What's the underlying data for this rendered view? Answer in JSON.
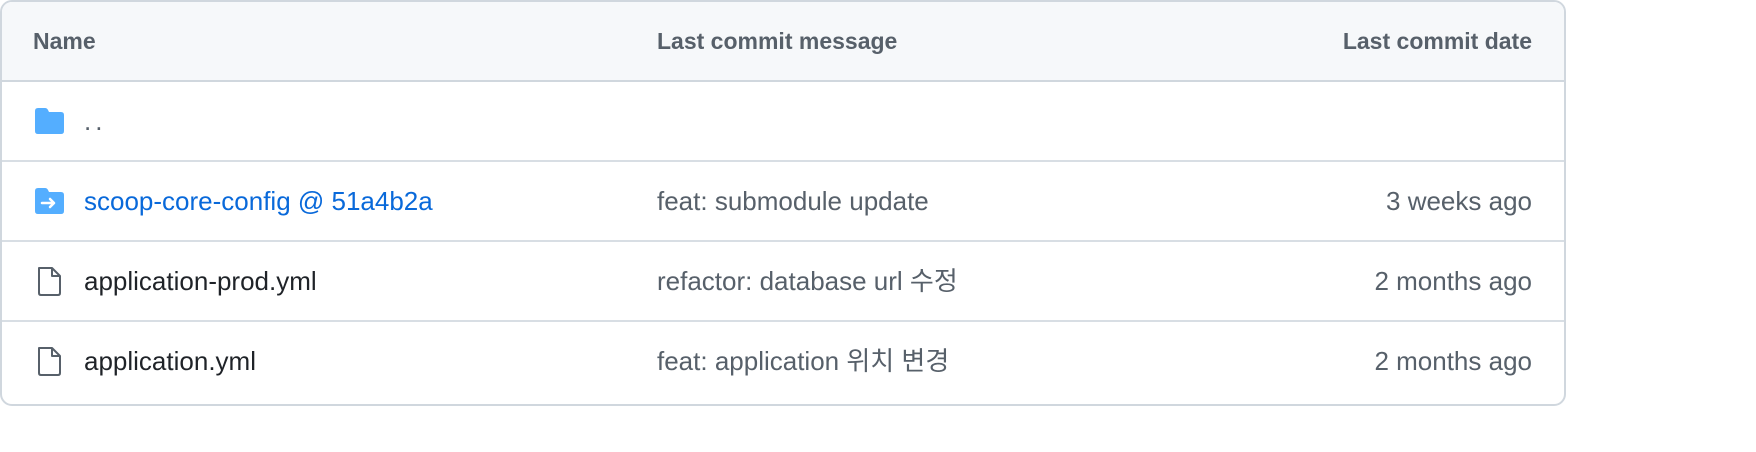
{
  "header": {
    "name": "Name",
    "message": "Last commit message",
    "date": "Last commit date"
  },
  "rows": [
    {
      "icon": "folder-icon",
      "name": "..",
      "message": "",
      "date": ""
    },
    {
      "icon": "submodule-folder-icon",
      "name": "scoop-core-config @ 51a4b2a",
      "message": "feat: submodule update",
      "date": "3 weeks ago"
    },
    {
      "icon": "file-icon",
      "name": "application-prod.yml",
      "message": "refactor: database url 수정",
      "date": "2 months ago"
    },
    {
      "icon": "file-icon",
      "name": "application.yml",
      "message": "feat: application 위치 변경",
      "date": "2 months ago"
    }
  ],
  "colors": {
    "folder": "#54aeff",
    "link": "#0969da",
    "muted": "#57606a",
    "text": "#1f2328",
    "border": "#d0d7de",
    "header_bg": "#f6f8fa"
  }
}
